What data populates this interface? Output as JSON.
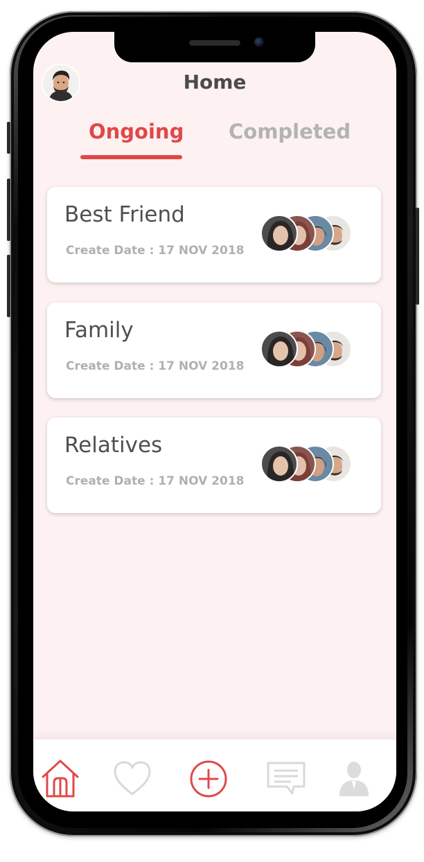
{
  "header": {
    "title": "Home",
    "avatar_icon": "user-avatar-man"
  },
  "tabs": [
    {
      "label": "Ongoing",
      "active": true
    },
    {
      "label": "Completed",
      "active": false
    }
  ],
  "groups": [
    {
      "name": "Best Friend",
      "create_date": "Create Date : 17 NOV 2018"
    },
    {
      "name": "Family",
      "create_date": "Create Date : 17 NOV 2018"
    },
    {
      "name": "Relatives",
      "create_date": "Create Date : 17 NOV 2018"
    }
  ],
  "bottom_nav": [
    {
      "icon": "home-icon",
      "active": true
    },
    {
      "icon": "heart-icon",
      "active": false
    },
    {
      "icon": "add-circle-icon",
      "active": false
    },
    {
      "icon": "chat-icon",
      "active": false
    },
    {
      "icon": "profile-icon",
      "active": false
    }
  ],
  "colors": {
    "accent": "#e04848",
    "background": "#fdf1f1",
    "inactive": "#b3b3b3",
    "text": "#4f4f4f"
  }
}
